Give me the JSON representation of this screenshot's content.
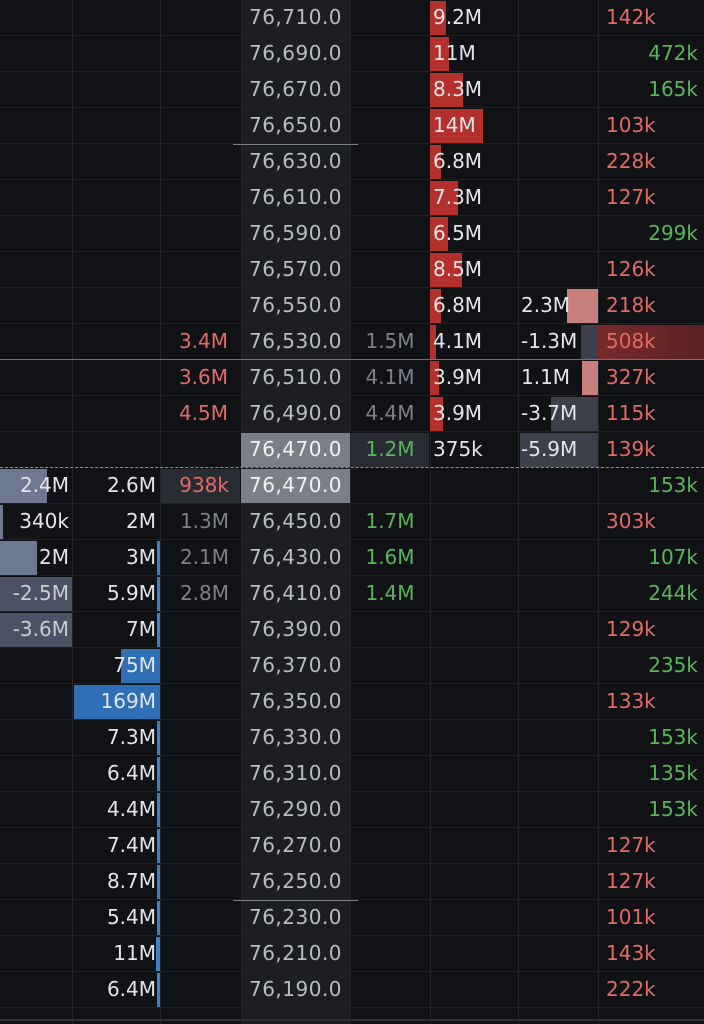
{
  "colors": {
    "background": "#111216",
    "price_column_bg": "#1d1e22",
    "price_highlight": "#7a7f88",
    "ask_bar": "#b3302c",
    "bid_bar": "#3a82c8",
    "bid_bar_light": "#2f6fb5",
    "delta_pos": "#c8817d",
    "delta_neg": "#3b404b",
    "cum_delta_pos": "#6e7890",
    "cum_delta_neg": "#4b5263",
    "big_trade_hot": "#7a2a2b",
    "text_green": "#59b55a",
    "text_red": "#e26b66",
    "text_grey": "#7d8088",
    "text_white": "#e2e4e8"
  },
  "rows": [
    {
      "price": "76,710.0",
      "ask": "9.2M",
      "ask_frac": 0.18,
      "vol": "142k",
      "vol_color": "red"
    },
    {
      "price": "76,690.0",
      "ask": "11M",
      "ask_frac": 0.22,
      "vol": "472k",
      "vol_color": "green"
    },
    {
      "price": "76,670.0",
      "ask": "8.3M",
      "ask_frac": 0.38,
      "vol": "165k",
      "vol_color": "green"
    },
    {
      "price": "76,650.0",
      "ask": "14M",
      "ask_frac": 0.6,
      "vol": "103k",
      "vol_color": "red",
      "tick_below": true
    },
    {
      "price": "76,630.0",
      "ask": "6.8M",
      "ask_frac": 0.12,
      "vol": "228k",
      "vol_color": "red"
    },
    {
      "price": "76,610.0",
      "ask": "7.3M",
      "ask_frac": 0.32,
      "vol": "127k",
      "vol_color": "red"
    },
    {
      "price": "76,590.0",
      "ask": "6.5M",
      "ask_frac": 0.2,
      "vol": "299k",
      "vol_color": "green"
    },
    {
      "price": "76,570.0",
      "ask": "8.5M",
      "ask_frac": 0.36,
      "vol": "126k",
      "vol_color": "red"
    },
    {
      "price": "76,550.0",
      "ask": "6.8M",
      "ask_frac": 0.12,
      "delta": "2.3M",
      "delta_frac": 0.4,
      "delta_kind": "pos",
      "vol": "218k",
      "vol_color": "red"
    },
    {
      "bid_ord": "3.4M",
      "bid_ord_color": "red",
      "price": "76,530.0",
      "trade": "1.5M",
      "trade_color": "grey",
      "ask": "4.1M",
      "ask_frac": 0.07,
      "delta": "-1.3M",
      "delta_frac": 0.22,
      "delta_kind": "neg",
      "vol": "508k",
      "vol_color": "red",
      "vol_hot": true,
      "sep_below": "solid"
    },
    {
      "bid_ord": "3.6M",
      "bid_ord_color": "red",
      "price": "76,510.0",
      "trade": "4.1M",
      "trade_color": "grey",
      "ask": "3.9M",
      "ask_frac": 0.1,
      "delta": "1.1M",
      "delta_frac": 0.2,
      "delta_kind": "pos",
      "vol": "327k",
      "vol_color": "red"
    },
    {
      "bid_ord": "4.5M",
      "bid_ord_color": "red",
      "price": "76,490.0",
      "trade": "4.4M",
      "trade_color": "grey",
      "ask": "3.9M",
      "ask_frac": 0.15,
      "delta": "-3.7M",
      "delta_frac": 0.6,
      "delta_kind": "neg",
      "vol": "115k",
      "vol_color": "red"
    },
    {
      "price": "76,470.0",
      "price_hl": true,
      "trade": "1.2M",
      "trade_color": "green",
      "trade_hl": true,
      "ask": "375k",
      "delta": "-5.9M",
      "delta_frac": 1.0,
      "delta_kind": "neg",
      "vol": "139k",
      "vol_color": "red",
      "sep_below": "dash"
    },
    {
      "cum": "2.4M",
      "cum_frac": 0.65,
      "cum_kind": "pos",
      "bid": "2.6M",
      "ord": "938k",
      "ord_color": "red",
      "ord_hl": true,
      "price": "76,470.0",
      "price_hl": true,
      "vol": "153k",
      "vol_color": "green"
    },
    {
      "cum": "340k",
      "cum_frac": 0.04,
      "cum_kind": "pos",
      "bid": "2M",
      "ord": "1.3M",
      "ord_color": "grey",
      "price": "76,450.0",
      "trade": "1.7M",
      "trade_color": "green",
      "vol": "303k",
      "vol_color": "red"
    },
    {
      "cum": "2M",
      "cum_frac": 0.52,
      "cum_kind": "pos",
      "bid": "3M",
      "bid_frac": 0.03,
      "ord": "2.1M",
      "ord_color": "grey",
      "price": "76,430.0",
      "trade": "1.6M",
      "trade_color": "green",
      "vol": "107k",
      "vol_color": "green"
    },
    {
      "cum": "-2.5M",
      "cum_frac": 1.0,
      "cum_kind": "neg",
      "bid": "5.9M",
      "bid_frac": 0.03,
      "ord": "2.8M",
      "ord_color": "grey",
      "price": "76,410.0",
      "trade": "1.4M",
      "trade_color": "green",
      "vol": "244k",
      "vol_color": "green"
    },
    {
      "cum": "-3.6M",
      "cum_frac": 1.0,
      "cum_kind": "neg",
      "bid": "7M",
      "bid_frac": 0.03,
      "price": "76,390.0",
      "vol": "129k",
      "vol_color": "red"
    },
    {
      "bid": "75M",
      "bid_frac": 0.45,
      "price": "76,370.0",
      "vol": "235k",
      "vol_color": "green"
    },
    {
      "bid": "169M",
      "bid_frac": 1.0,
      "price": "76,350.0",
      "vol": "133k",
      "vol_color": "red"
    },
    {
      "bid": "7.3M",
      "bid_frac": 0.03,
      "price": "76,330.0",
      "vol": "153k",
      "vol_color": "green"
    },
    {
      "bid": "6.4M",
      "bid_frac": 0.03,
      "price": "76,310.0",
      "vol": "135k",
      "vol_color": "green"
    },
    {
      "bid": "4.4M",
      "bid_frac": 0.03,
      "price": "76,290.0",
      "vol": "153k",
      "vol_color": "green"
    },
    {
      "bid": "7.4M",
      "bid_frac": 0.03,
      "price": "76,270.0",
      "vol": "127k",
      "vol_color": "red"
    },
    {
      "bid": "8.7M",
      "bid_frac": 0.03,
      "price": "76,250.0",
      "vol": "127k",
      "vol_color": "red",
      "tick_below": true
    },
    {
      "bid": "5.4M",
      "bid_frac": 0.03,
      "price": "76,230.0",
      "vol": "101k",
      "vol_color": "red"
    },
    {
      "bid": "11M",
      "bid_frac": 0.05,
      "price": "76,210.0",
      "vol": "143k",
      "vol_color": "red"
    },
    {
      "bid": "6.4M",
      "bid_frac": 0.03,
      "price": "76,190.0",
      "vol": "222k",
      "vol_color": "red"
    }
  ]
}
